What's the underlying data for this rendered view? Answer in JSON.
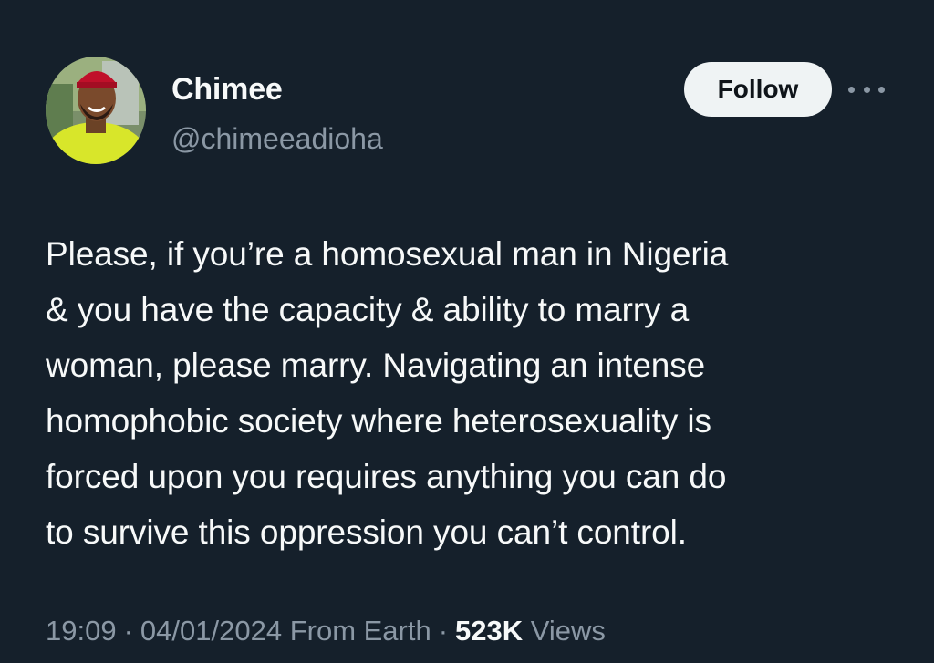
{
  "author": {
    "display_name": "Chimee",
    "handle": "@chimeeadioha",
    "avatar_icon": "profile-photo"
  },
  "actions": {
    "follow_label": "Follow",
    "more_icon": "more-horizontal-icon"
  },
  "tweet": {
    "text": "Please, if you’re a homosexual man in Nigeria\n& you have the capacity & ability to marry a\nwoman, please marry. Navigating an intense\nhomophobic society where heterosexuality is\nforced upon you requires anything you can do\nto survive this oppression you can’t control."
  },
  "meta": {
    "time": "19:09",
    "separator": "·",
    "date": "04/01/2024",
    "source": "From Earth",
    "views_count": "523K",
    "views_label": "Views"
  },
  "colors": {
    "background": "#15202b",
    "primary_text": "#f7f9f9",
    "secondary_text": "#8b98a5",
    "follow_button_bg": "#eff3f4",
    "follow_button_text": "#0f1419"
  }
}
